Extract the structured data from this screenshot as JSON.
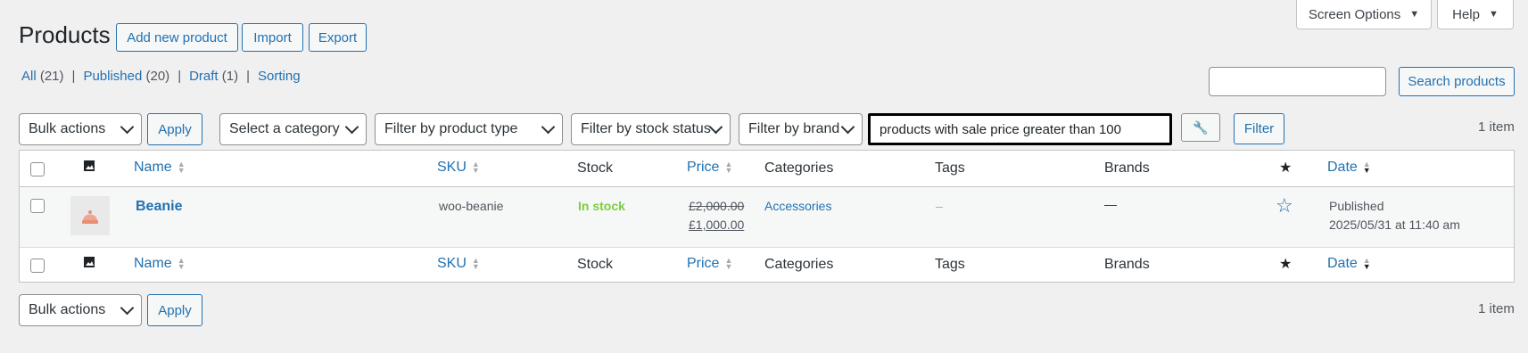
{
  "screen_options": {
    "label": "Screen Options",
    "help_label": "Help"
  },
  "header": {
    "title": "Products",
    "add_new_label": "Add new product",
    "import_label": "Import",
    "export_label": "Export"
  },
  "views": [
    {
      "label": "All",
      "count": "(21)"
    },
    {
      "label": "Published",
      "count": "(20)"
    },
    {
      "label": "Draft",
      "count": "(1)"
    },
    {
      "label": "Sorting",
      "count": ""
    }
  ],
  "search": {
    "value": "",
    "button_label": "Search products"
  },
  "toolbar": {
    "bulk_actions": "Bulk actions",
    "apply_label": "Apply",
    "category_select": "Select a category",
    "product_type_select": "Filter by product type",
    "stock_status_select": "Filter by stock status",
    "brand_select": "Filter by brand",
    "query_value": "products with sale price greater than 100",
    "filter_label": "Filter",
    "item_count": "1 item"
  },
  "columns": {
    "name": "Name",
    "sku": "SKU",
    "stock": "Stock",
    "price": "Price",
    "categories": "Categories",
    "tags": "Tags",
    "brands": "Brands",
    "date": "Date"
  },
  "rows": [
    {
      "name": "Beanie",
      "sku": "woo-beanie",
      "stock": "In stock",
      "regular_price": "£2,000.00",
      "sale_price": "£1,000.00",
      "category": "Accessories",
      "tags": "–",
      "brands": "—",
      "status": "Published",
      "date": "2025/05/31 at 11:40 am"
    }
  ],
  "footer": {
    "bulk_actions": "Bulk actions",
    "apply_label": "Apply",
    "item_count": "1 item"
  },
  "colors": {
    "link": "#2271b1",
    "in_stock": "#7ad03a",
    "background": "#f0f0f1"
  },
  "icons": [
    "image-icon",
    "star-icon",
    "star-outline-icon",
    "wand-icon",
    "chevron-down-icon",
    "sort-icon"
  ]
}
